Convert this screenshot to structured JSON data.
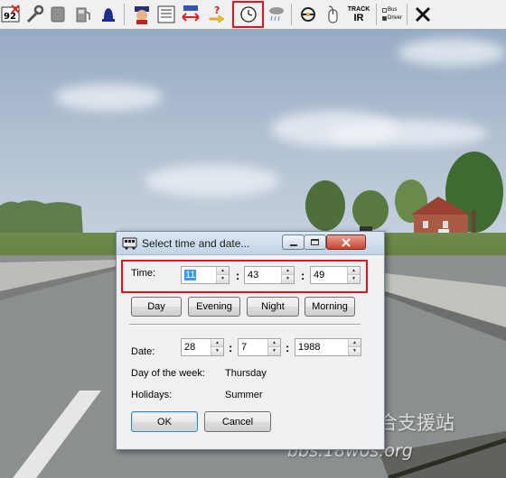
{
  "toolbar": {
    "items": [
      {
        "name": "vehicle-number-tool",
        "label": "92"
      },
      {
        "name": "wrench-tool"
      },
      {
        "name": "grey-box-tool"
      },
      {
        "name": "fuel-tool"
      },
      {
        "name": "bell-tool"
      },
      {
        "name": "driver-tool"
      },
      {
        "name": "notes-tool"
      },
      {
        "name": "swap-tool"
      },
      {
        "name": "help-tool"
      },
      {
        "name": "clock-tool"
      },
      {
        "name": "weather-tool"
      },
      {
        "name": "steering-tool"
      },
      {
        "name": "mouse-tool"
      },
      {
        "name": "trackir-tool",
        "label_top": "TRACK",
        "label_bottom": "IR"
      },
      {
        "name": "options-tool",
        "line1": "Bus",
        "line2": "Driver"
      },
      {
        "name": "close-tool"
      }
    ]
  },
  "dialog": {
    "title": "Select time and date...",
    "time_label": "Time:",
    "hour": "11",
    "minute": "43",
    "second": "49",
    "buttons": {
      "day": "Day",
      "evening": "Evening",
      "night": "Night",
      "morning": "Morning"
    },
    "date_label": "Date:",
    "day_value": "28",
    "month_value": "7",
    "year_value": "1988",
    "weekday_label": "Day of the week:",
    "weekday_value": "Thursday",
    "holidays_label": "Holidays:",
    "holidays_value": "Summer",
    "ok_label": "OK",
    "cancel_label": "Cancel",
    "colon": ":"
  },
  "watermark": {
    "line1": "卡车游戏综合支援站",
    "line2": "bbs.18wos.org"
  },
  "colors": {
    "highlight": "#e0141e",
    "selection": "#3399ff"
  }
}
